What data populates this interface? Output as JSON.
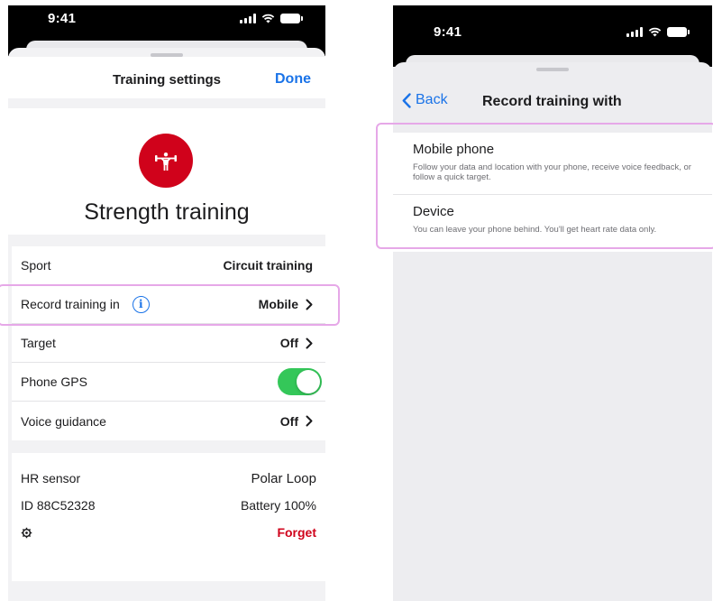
{
  "left_screen": {
    "status_time": "9:41",
    "nav": {
      "title": "Training settings",
      "done_label": "Done"
    },
    "hero": {
      "icon": "strength-figure-icon",
      "title": "Strength training",
      "accent": "#d0021b"
    },
    "rows": {
      "sport": {
        "label": "Sport",
        "value": "Circuit training"
      },
      "record": {
        "label": "Record training in",
        "value": "Mobile"
      },
      "target": {
        "label": "Target",
        "value": "Off"
      },
      "gps": {
        "label": "Phone GPS",
        "enabled": true
      },
      "voice": {
        "label": "Voice guidance",
        "value": "Off"
      }
    },
    "device": {
      "hr_label": "HR sensor",
      "hr_value": "Polar Loop",
      "id_label": "ID 88C52328",
      "battery_value": "Battery 100%",
      "settings_icon": "gear-icon",
      "forget_label": "Forget"
    }
  },
  "right_screen": {
    "status_time": "9:41",
    "nav": {
      "back_label": "Back",
      "title": "Record training with"
    },
    "options": [
      {
        "title": "Mobile phone",
        "description": "Follow your data and location with your phone, receive voice feedback, or follow a quick target."
      },
      {
        "title": "Device",
        "description": "You can leave your phone behind. You'll get heart rate data only."
      }
    ]
  },
  "colors": {
    "link": "#1a73e8",
    "toggle_on": "#34c759",
    "danger": "#d0021b",
    "highlight": "#e6a8e8"
  }
}
